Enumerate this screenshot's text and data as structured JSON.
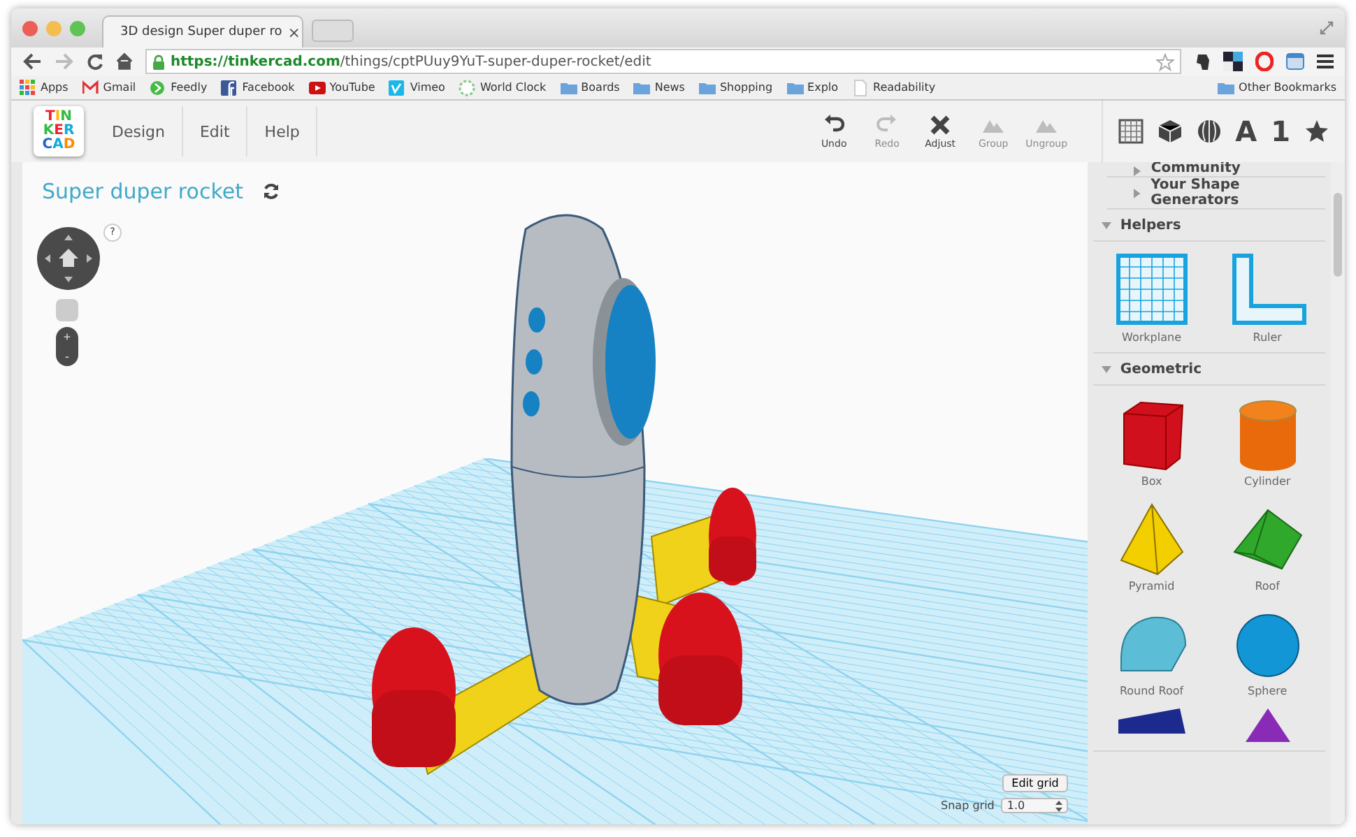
{
  "browser": {
    "tab_title": "3D design Super duper ro",
    "tab_close": "×",
    "url_host": "https://tinkercad.com",
    "url_path": "/things/cptPUuy9YuT-super-duper-rocket/edit",
    "bookmarks": [
      {
        "label": "Apps",
        "kind": "apps"
      },
      {
        "label": "Gmail",
        "kind": "mail"
      },
      {
        "label": "Feedly",
        "kind": "feed"
      },
      {
        "label": "Facebook",
        "kind": "fb"
      },
      {
        "label": "YouTube",
        "kind": "video"
      },
      {
        "label": "Vimeo",
        "kind": "vimeo"
      },
      {
        "label": "World Clock",
        "kind": "clock"
      },
      {
        "label": "Boards",
        "kind": "folder"
      },
      {
        "label": "News",
        "kind": "folder"
      },
      {
        "label": "Shopping",
        "kind": "folder"
      },
      {
        "label": "Explo",
        "kind": "folder"
      },
      {
        "label": "Readability",
        "kind": "page"
      }
    ],
    "other_bookmarks": "Other Bookmarks"
  },
  "app": {
    "logo_rows": [
      "TIN",
      "KER",
      "CAD"
    ],
    "menu": [
      "Design",
      "Edit",
      "Help"
    ],
    "tools": [
      {
        "label": "Undo",
        "kind": "undo",
        "disabled": false
      },
      {
        "label": "Redo",
        "kind": "redo",
        "disabled": true
      },
      {
        "label": "Adjust",
        "kind": "adjust",
        "disabled": false
      },
      {
        "label": "Group",
        "kind": "group",
        "disabled": true
      },
      {
        "label": "Ungroup",
        "kind": "group",
        "disabled": true
      }
    ],
    "panel_tabs": [
      {
        "kind": "grid"
      },
      {
        "kind": "cube"
      },
      {
        "kind": "ball"
      },
      {
        "kind": "text",
        "label": "A"
      },
      {
        "kind": "text",
        "label": "1"
      },
      {
        "kind": "star"
      }
    ]
  },
  "canvas": {
    "title": "Super duper rocket",
    "help": "?",
    "zoom_in": "+",
    "zoom_out": "-",
    "edit_grid": "Edit grid",
    "snap_label": "Snap grid",
    "snap_value": "1.0"
  },
  "sidebar": {
    "sections": [
      {
        "title": "Community",
        "expanded": false,
        "sub": true
      },
      {
        "title": "Your Shape Generators",
        "expanded": false,
        "sub": true
      },
      {
        "title": "Helpers",
        "expanded": true,
        "sub": false,
        "items": [
          {
            "label": "Workplane",
            "kind": "workplane"
          },
          {
            "label": "Ruler",
            "kind": "ruler"
          }
        ]
      },
      {
        "title": "Geometric",
        "expanded": true,
        "sub": false,
        "items": [
          {
            "label": "Box",
            "kind": "box"
          },
          {
            "label": "Cylinder",
            "kind": "cylinder"
          },
          {
            "label": "Pyramid",
            "kind": "pyramid"
          },
          {
            "label": "Roof",
            "kind": "roof"
          },
          {
            "label": "Round Roof",
            "kind": "roundroof"
          },
          {
            "label": "Sphere",
            "kind": "sphere"
          },
          {
            "kind": "wedge"
          },
          {
            "kind": "cone"
          }
        ]
      }
    ]
  }
}
